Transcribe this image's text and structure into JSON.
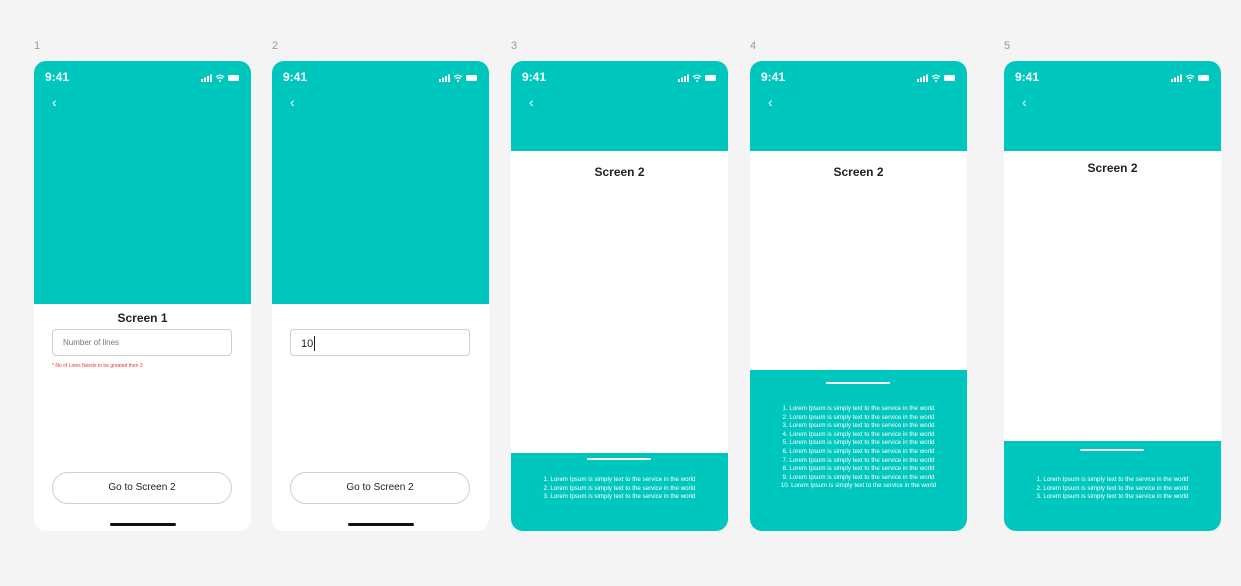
{
  "screens": [
    {
      "number": "1",
      "time": "9:41",
      "back": "‹",
      "title": "Screen 1",
      "input": {
        "placeholder": "Number of lines",
        "value": ""
      },
      "error": "* No of Lines Needs to be greated then 3",
      "button": "Go to Screen 2"
    },
    {
      "number": "2",
      "time": "9:41",
      "back": "‹",
      "input": {
        "value": "10"
      },
      "button": "Go to Screen 2"
    },
    {
      "number": "3",
      "time": "9:41",
      "back": "‹",
      "title": "Screen 2",
      "lines": [
        "1. Lorem Ipsum is simply text to the service in the world",
        "2. Lorem Ipsum is simply text to the service in the world",
        "3. Lorem Ipsum is simply text to the service in the world"
      ]
    },
    {
      "number": "4",
      "time": "9:41",
      "back": "‹",
      "title": "Screen 2",
      "lines": [
        "1. Lorem Ipsum is simply text to the service in the world",
        "2. Lorem Ipsum is simply text to the service in the world",
        "3. Lorem Ipsum is simply text to the service in the world",
        "4. Lorem Ipsum is simply text to the service in the world",
        "5. Lorem Ipsum is simply text to the service in the world",
        "6. Lorem Ipsum is simply text to the service in the world",
        "7. Lorem Ipsum is simply text to the service in the world",
        "8. Lorem Ipsum is simply text to the service in the world",
        "9. Lorem Ipsum is simply text to the service in the world",
        "10. Lorem Ipsum is simply text to the service in the world"
      ]
    },
    {
      "number": "5",
      "time": "9:41",
      "back": "‹",
      "title": "Screen 2",
      "lines": [
        "1. Lorem Ipsum is simply text to the service in the world",
        "2. Lorem Ipsum is simply text to the service in the world",
        "3. Lorem Ipsum is simply text to the service in the world"
      ]
    }
  ],
  "icons": [
    "signal-icon",
    "wifi-icon",
    "battery-icon",
    "back-icon"
  ],
  "colors": {
    "teal": "#00c7be",
    "error": "#e53935",
    "background": "#f4f4f4"
  }
}
